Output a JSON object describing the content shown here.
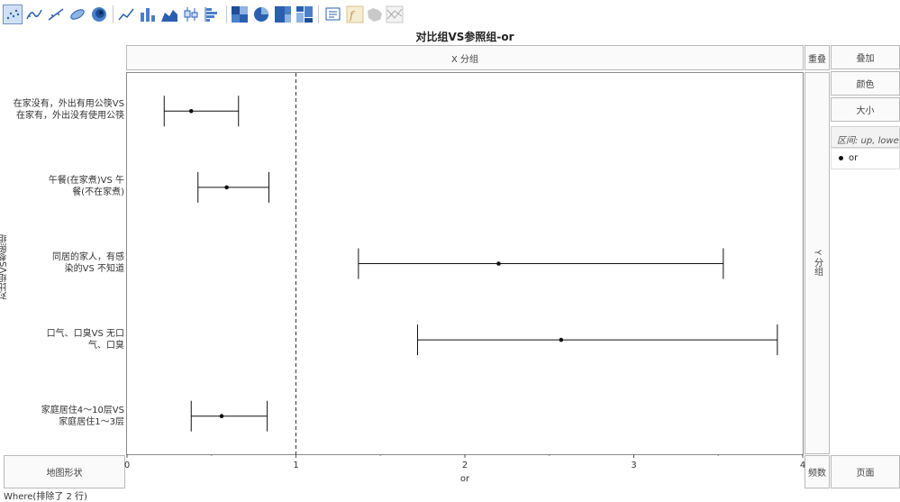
{
  "toolbar": {
    "icons": [
      "points-icon",
      "smoother-icon",
      "line-fit-icon",
      "ellipse-icon",
      "contour-icon",
      "line-icon",
      "bar-icon",
      "area-icon",
      "box-plot-icon",
      "histogram-icon",
      "heatmap-icon",
      "pie-icon",
      "treemap-icon",
      "mosaic-icon",
      "caption-box-icon",
      "formula-icon",
      "map-shape-icon",
      "parallel-icon"
    ]
  },
  "zones": {
    "x_group": "X 分组",
    "overlay": "重叠",
    "add": "叠加",
    "color": "颜色",
    "size": "大小",
    "y_group": "Y 分组",
    "map_shape": "地图形状",
    "freq": "频数",
    "page": "页面"
  },
  "legend": {
    "title": "区间: up, lower",
    "items": [
      "or"
    ]
  },
  "footer": "Where(排除了 2 行)",
  "chart_data": {
    "type": "forest",
    "title": "对比组VS参照组-or",
    "xlabel": "or",
    "ylabel": "对比组VS参照组",
    "xlim": [
      0,
      4
    ],
    "xticks": [
      "0",
      "1",
      "2",
      "3",
      "4"
    ],
    "reference_line": 1,
    "categories": [
      [
        "在家没有，外出有用公筷VS",
        "在家有，外出没有使用公筷"
      ],
      [
        "午餐(在家煮)VS 午",
        "餐(不在家煮)"
      ],
      [
        "同居的家人，有感",
        "染的VS 不知道"
      ],
      [
        "口气、口臭VS 无口",
        "气、口臭"
      ],
      [
        "家庭居住4～10层VS",
        "家庭居住1～3层"
      ]
    ],
    "series": [
      {
        "name": "or",
        "points": [
          {
            "or": 0.38,
            "lower": 0.22,
            "up": 0.66
          },
          {
            "or": 0.59,
            "lower": 0.42,
            "up": 0.84
          },
          {
            "or": 2.2,
            "lower": 1.37,
            "up": 3.53
          },
          {
            "or": 2.57,
            "lower": 1.72,
            "up": 3.85
          },
          {
            "or": 0.56,
            "lower": 0.38,
            "up": 0.83
          }
        ]
      }
    ]
  }
}
